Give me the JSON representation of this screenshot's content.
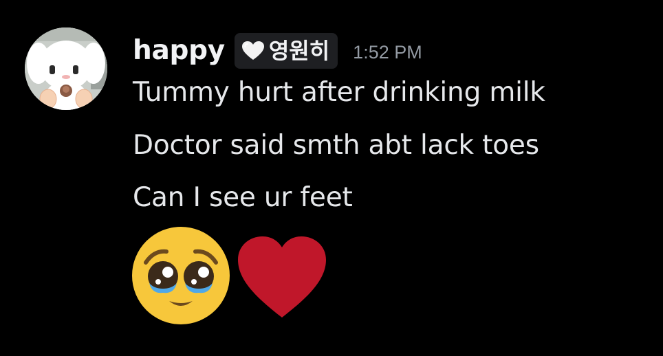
{
  "message": {
    "author": {
      "username": "happy",
      "role_tag": {
        "icon": "white-heart-icon",
        "label": "영원히",
        "background": "#1e1f22"
      },
      "avatar_icon": "bunny-avatar-icon"
    },
    "timestamp": "1:52 PM",
    "lines": [
      "Tummy hurt after drinking milk",
      "Doctor said smth abt lack toes",
      "Can I see ur feet"
    ],
    "emojis": [
      {
        "name": "pleading-face-emoji",
        "glyph": "🥺"
      },
      {
        "name": "red-heart-emoji",
        "glyph": "❤️"
      }
    ]
  },
  "colors": {
    "background": "#000000",
    "username": "#f2f3f5",
    "timestamp": "#949ba4",
    "text": "#e6e8eb",
    "heart": "#c0172a",
    "face": "#f7c73b"
  }
}
